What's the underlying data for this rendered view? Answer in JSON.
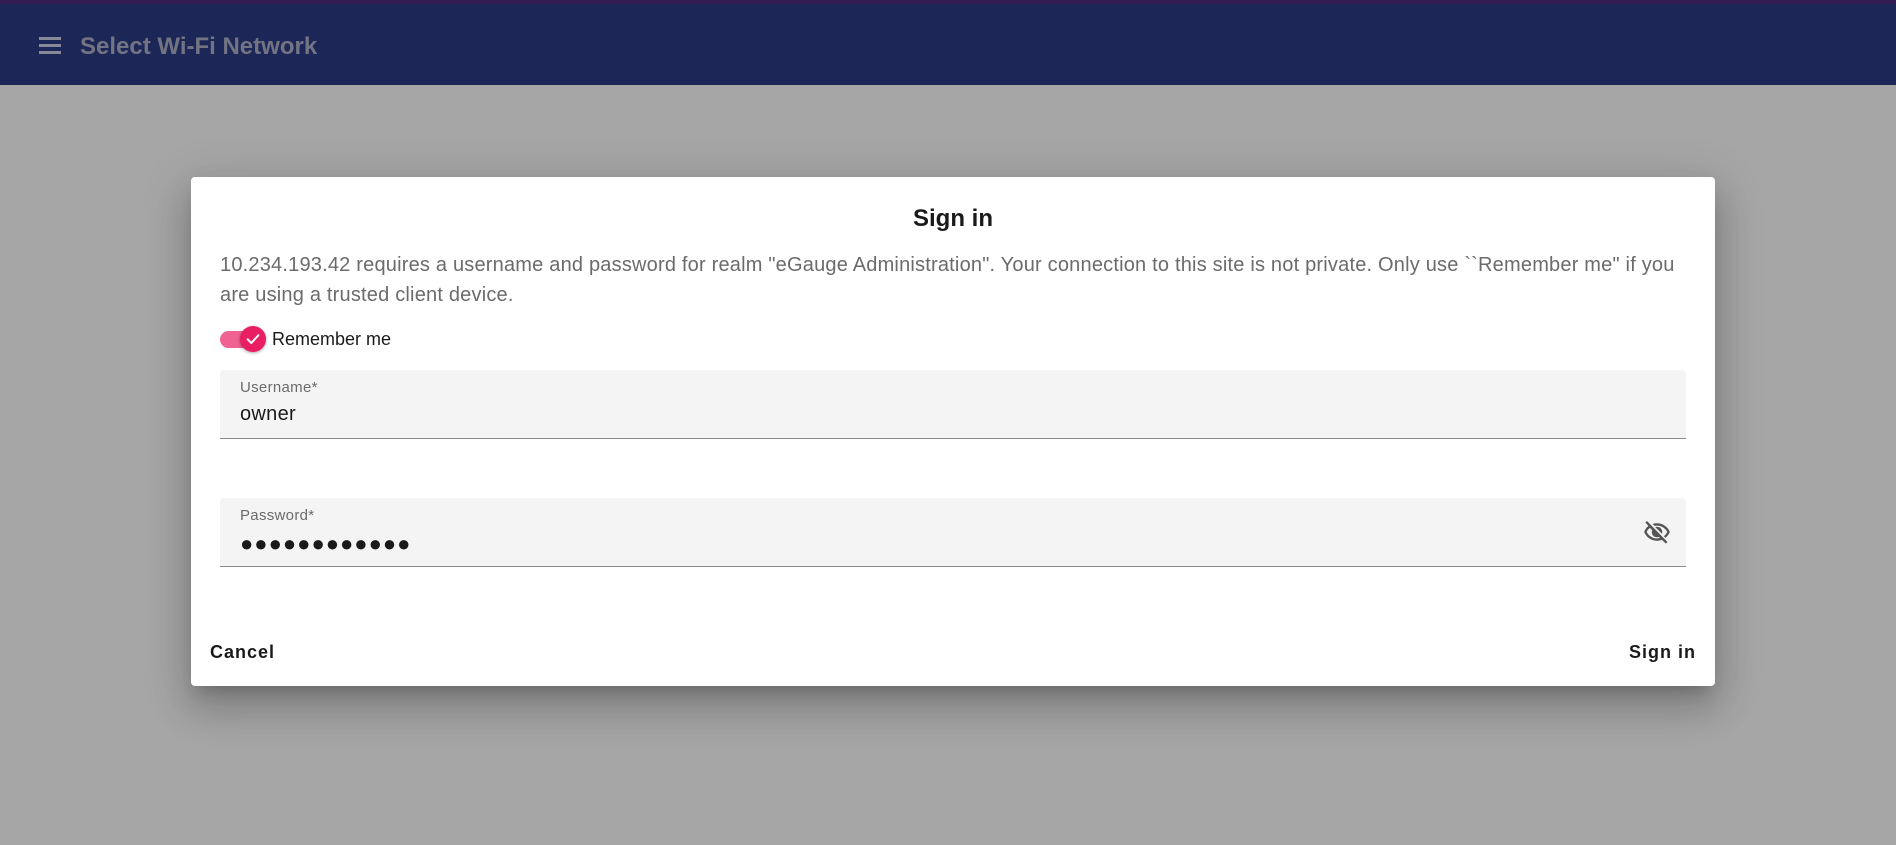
{
  "app": {
    "title": "Select Wi-Fi Network",
    "menu_icon": "menu-icon",
    "bar_color": "#2a3a80"
  },
  "dialog": {
    "title": "Sign in",
    "message": "10.234.193.42 requires a username and password for realm \"eGauge Administration\". Your connection to this site is not private. Only use ``Remember me\" if you are using a trusted client device.",
    "remember_me": {
      "label": "Remember me",
      "checked": true,
      "accent": "#e91e63"
    },
    "username": {
      "label": "Username*",
      "value": "owner"
    },
    "password": {
      "label": "Password*",
      "value": "●●●●●●●●●●●●",
      "toggle_icon": "visibility-off-icon"
    },
    "actions": {
      "cancel": "Cancel",
      "submit": "Sign in"
    }
  }
}
